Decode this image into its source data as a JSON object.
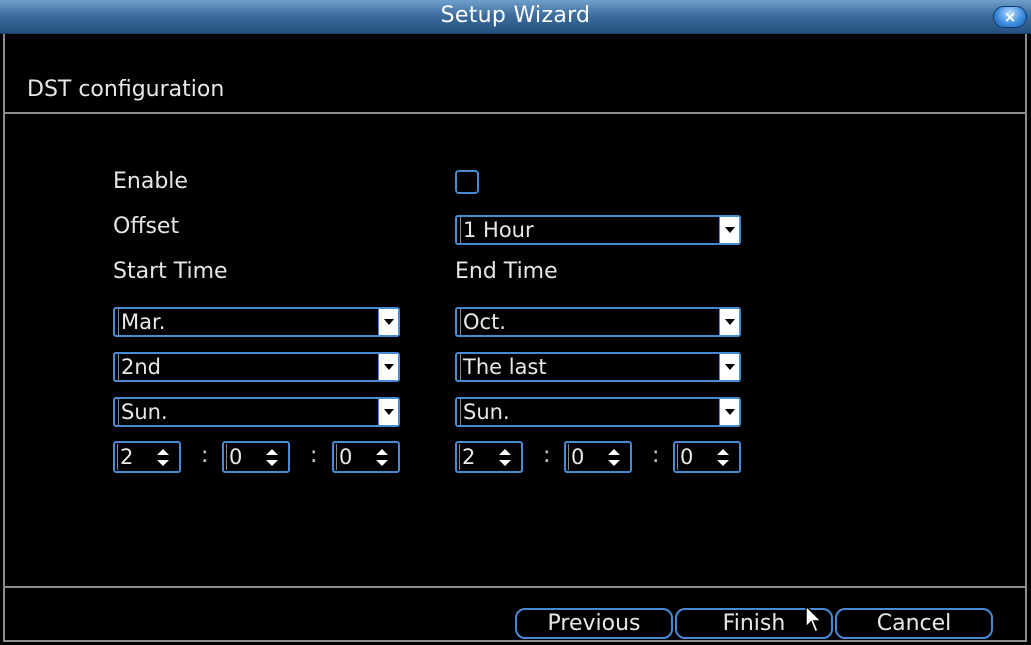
{
  "window": {
    "title": "Setup Wizard",
    "close_label": "×"
  },
  "section_title": "DST configuration",
  "enable": {
    "label": "Enable",
    "checked": false
  },
  "offset": {
    "label": "Offset",
    "value": "1 Hour"
  },
  "start_time": {
    "label": "Start Time",
    "month": "Mar.",
    "week": "2nd",
    "day": "Sun.",
    "hour": "2",
    "minute": "0",
    "second": "0"
  },
  "end_time": {
    "label": "End Time",
    "month": "Oct.",
    "week": "The last",
    "day": "Sun.",
    "hour": "2",
    "minute": "0",
    "second": "0"
  },
  "time_separator": ":",
  "buttons": {
    "previous": "Previous",
    "finish": "Finish",
    "cancel": "Cancel"
  },
  "colors": {
    "accent": "#4a8ad4",
    "titlebar": "#3f6f9f",
    "background": "#000000"
  }
}
